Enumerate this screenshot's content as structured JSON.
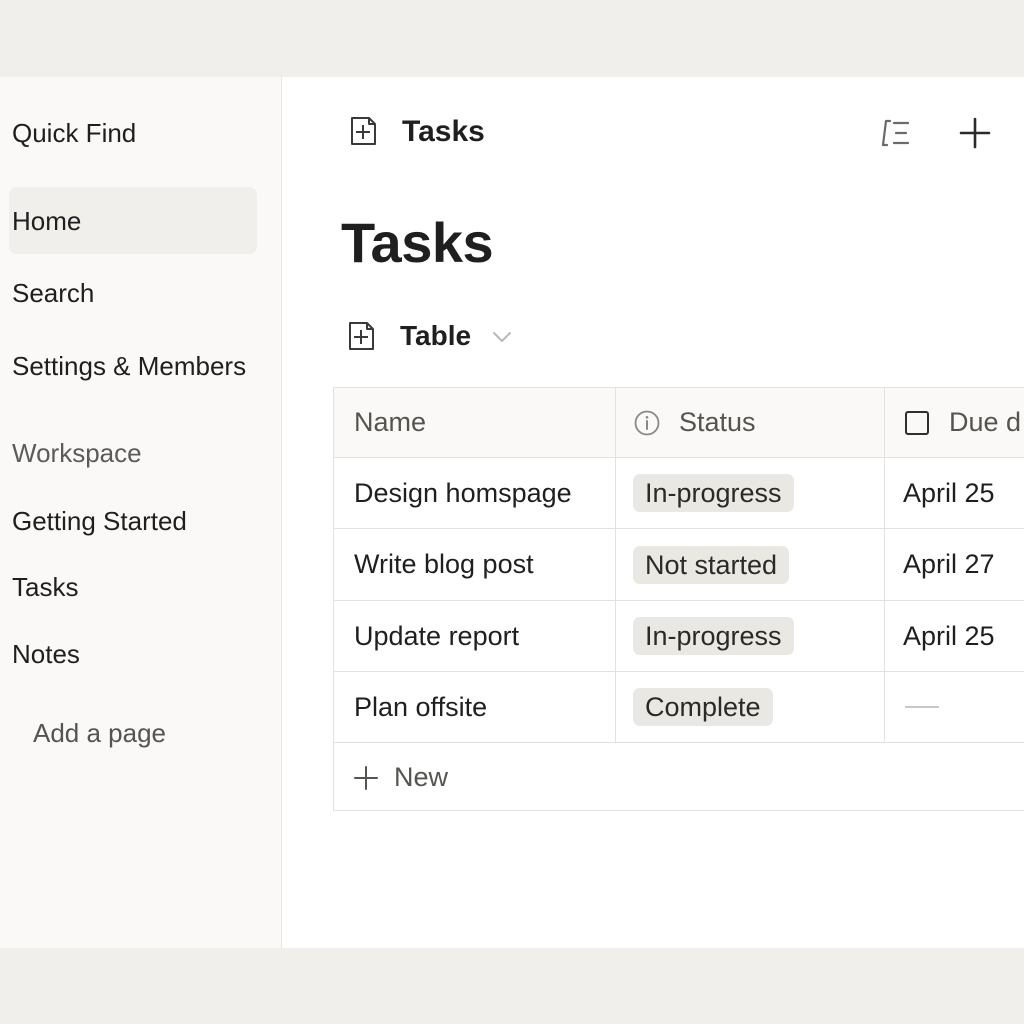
{
  "sidebar": {
    "quick_find": "Quick Find",
    "items": [
      {
        "label": "Home"
      },
      {
        "label": "Search"
      },
      {
        "label": "Settings & Members"
      }
    ],
    "workspace_label": "Workspace",
    "pages": [
      {
        "label": "Getting Started"
      },
      {
        "label": "Tasks"
      },
      {
        "label": "Notes"
      }
    ],
    "add_page": "Add a page"
  },
  "topbar": {
    "icon": "page-plus-icon",
    "title": "Tasks",
    "actions": [
      "outline-icon",
      "plus-icon"
    ]
  },
  "page": {
    "heading": "Tasks",
    "view": {
      "icon": "page-plus-icon",
      "label": "Table"
    }
  },
  "table": {
    "columns": [
      {
        "label": "Name"
      },
      {
        "label": "Status",
        "icon": "info-icon"
      },
      {
        "label": "Due d",
        "icon": "checkbox-icon"
      }
    ],
    "rows": [
      {
        "name": "Design homspage",
        "status": "In-progress",
        "due": "April 25"
      },
      {
        "name": "Write blog post",
        "status": "Not started",
        "due": "April 27"
      },
      {
        "name": "Update report",
        "status": "In-progress",
        "due": "April 25"
      },
      {
        "name": "Plan offsite",
        "status": "Complete",
        "due": ""
      }
    ],
    "new_label": "New"
  },
  "colors": {
    "sidebar_bg": "#faf9f7",
    "selected_bg": "#f0efec",
    "badge_bg": "#e9e8e3",
    "border": "#e3e2df"
  }
}
